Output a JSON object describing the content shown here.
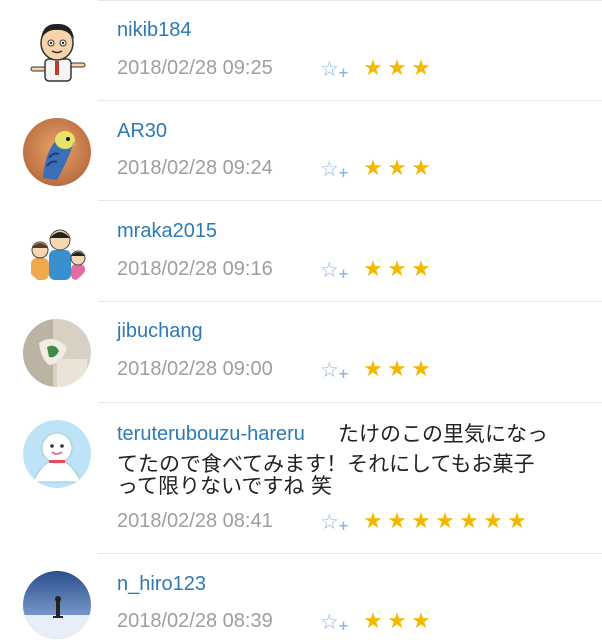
{
  "entries": [
    {
      "user": "nikib184",
      "comment": "",
      "timestamp": "2018/02/28 09:25",
      "stars": 3,
      "avatar_icon": "cartoon-boy-avatar"
    },
    {
      "user": "AR30",
      "comment": "",
      "timestamp": "2018/02/28 09:24",
      "stars": 3,
      "avatar_icon": "budgie-avatar"
    },
    {
      "user": "mraka2015",
      "comment": "",
      "timestamp": "2018/02/28 09:16",
      "stars": 3,
      "avatar_icon": "family-illustration-avatar"
    },
    {
      "user": "jibuchang",
      "comment": "",
      "timestamp": "2018/02/28 09:00",
      "stars": 3,
      "avatar_icon": "photo-avatar"
    },
    {
      "user": "teruterubouzu-hareru",
      "comment_line1": "たけのこの里気になっ",
      "comment_line2": "てたので食べてみます！それにしてもお菓子",
      "comment_line3": "って限りないですね 笑",
      "timestamp": "2018/02/28 08:41",
      "stars": 7,
      "avatar_icon": "teru-teru-bozu-avatar"
    },
    {
      "user": "n_hiro123",
      "comment": "",
      "timestamp": "2018/02/28 08:39",
      "stars": 3,
      "avatar_icon": "snow-landscape-avatar"
    }
  ],
  "icons": {
    "add_star": "star-outline-plus-icon",
    "star": "star-icon"
  },
  "colors": {
    "username": "#2b7ab5",
    "timestamp": "#9e9e9e",
    "star": "#f3b900",
    "add_star": "#8fb4d8"
  }
}
